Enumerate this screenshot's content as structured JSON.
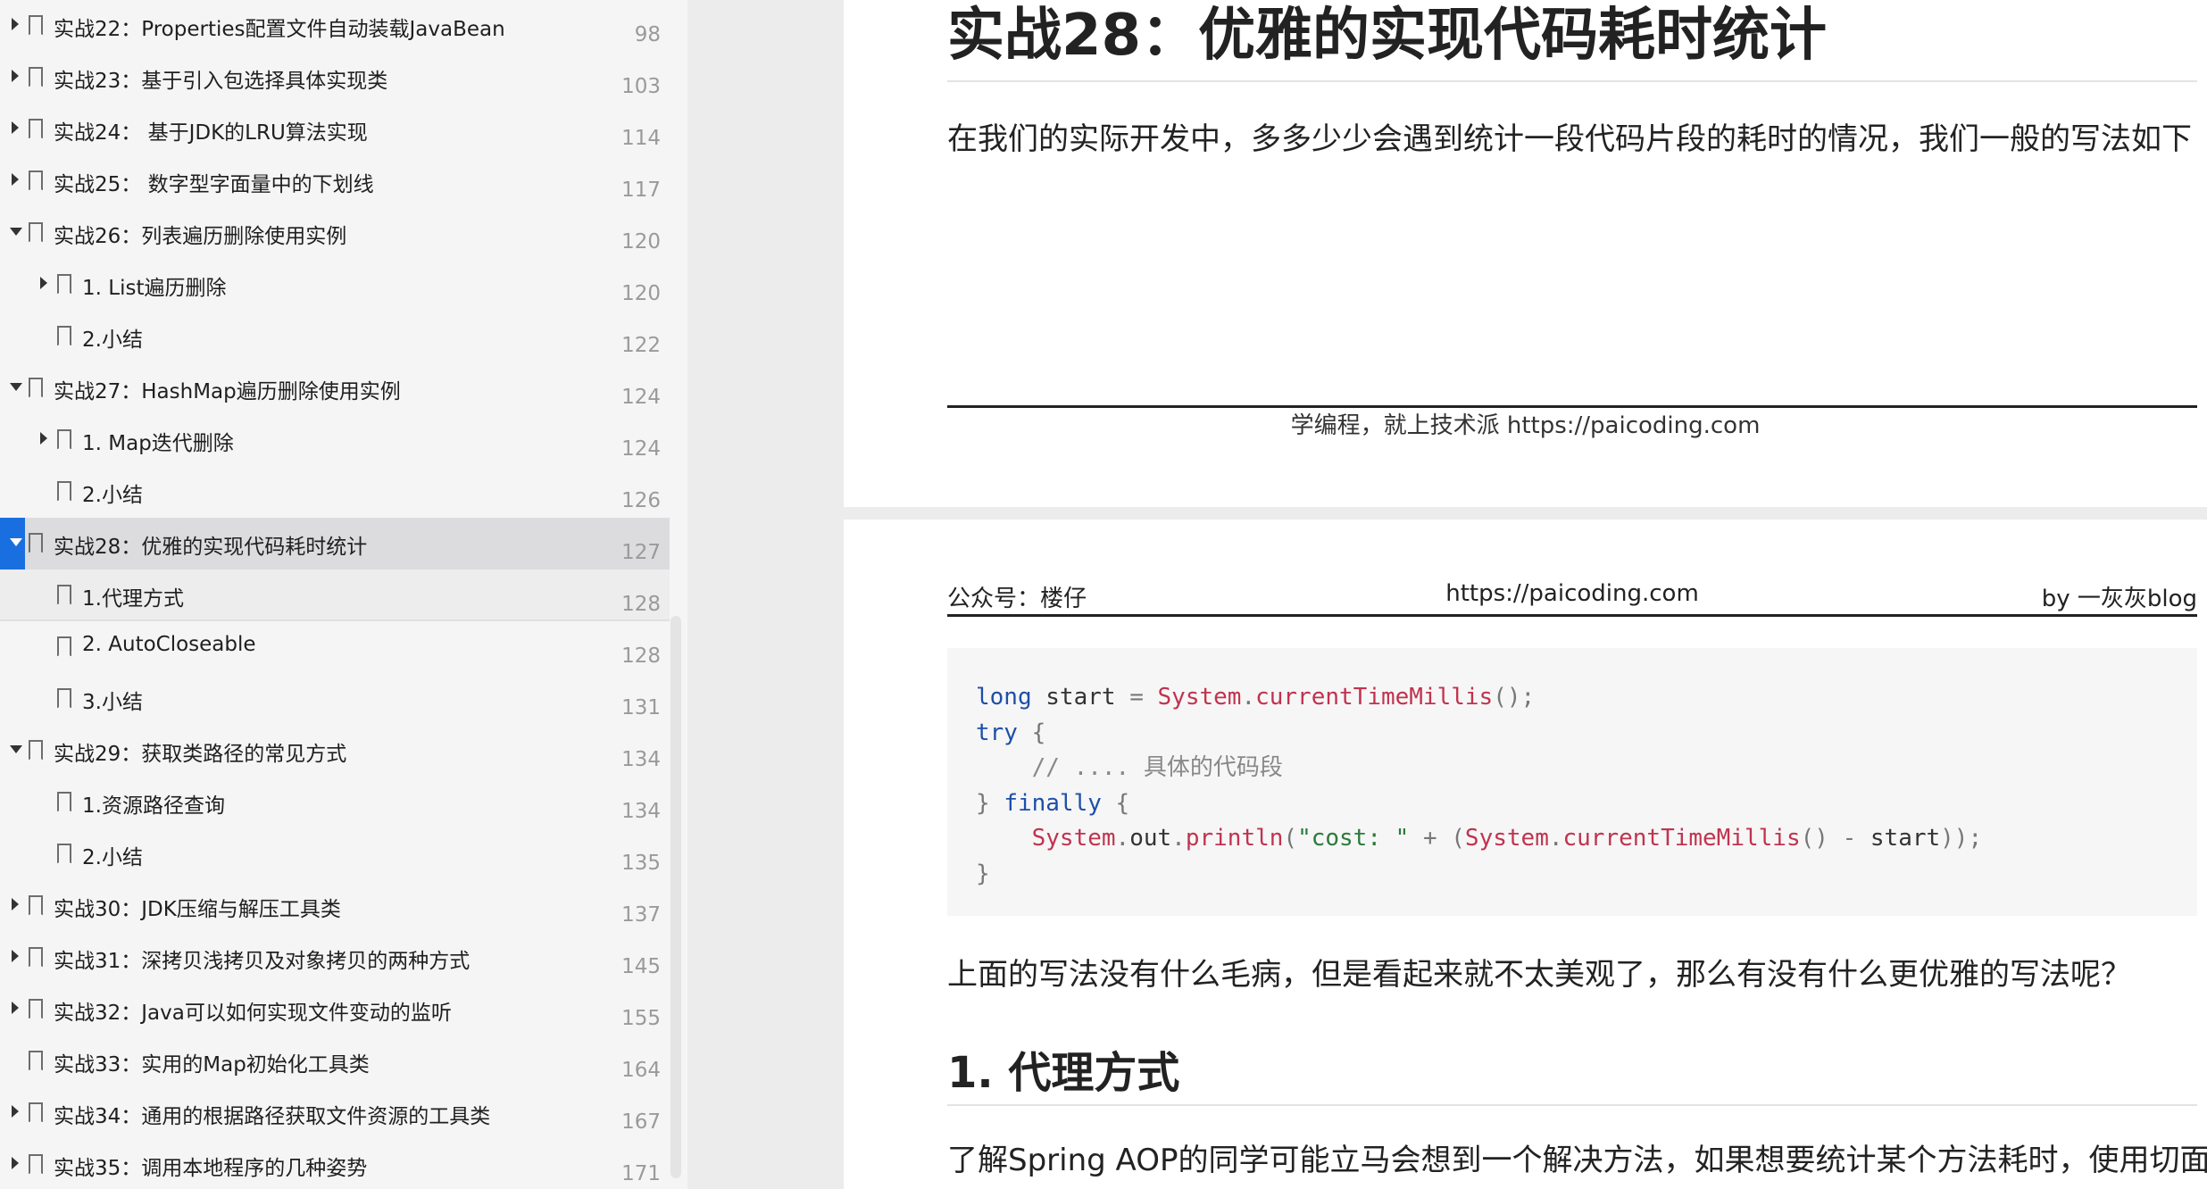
{
  "outline": {
    "items": [
      {
        "label": "实战22：Properties配置文件自动装载JavaBean",
        "page": "98",
        "level": 0,
        "arrow": "right"
      },
      {
        "label": "实战23：基于引入包选择具体实现类",
        "page": "103",
        "level": 0,
        "arrow": "right"
      },
      {
        "label": "实战24： 基于JDK的LRU算法实现",
        "page": "114",
        "level": 0,
        "arrow": "right"
      },
      {
        "label": "实战25： 数字型字面量中的下划线",
        "page": "117",
        "level": 0,
        "arrow": "right"
      },
      {
        "label": "实战26：列表遍历删除使用实例",
        "page": "120",
        "level": 0,
        "arrow": "down"
      },
      {
        "label": "1. List遍历删除",
        "page": "120",
        "level": 1,
        "arrow": "right"
      },
      {
        "label": "2.小结",
        "page": "122",
        "level": 1,
        "arrow": "none"
      },
      {
        "label": "实战27：HashMap遍历删除使用实例",
        "page": "124",
        "level": 0,
        "arrow": "down"
      },
      {
        "label": "1. Map迭代删除",
        "page": "124",
        "level": 1,
        "arrow": "right"
      },
      {
        "label": "2.小结",
        "page": "126",
        "level": 1,
        "arrow": "none"
      },
      {
        "label": "实战28：优雅的实现代码耗时统计",
        "page": "127",
        "level": 0,
        "arrow": "down",
        "selected": true
      },
      {
        "label": "1.代理方式",
        "page": "128",
        "level": 1,
        "arrow": "none",
        "hover": true
      },
      {
        "label": "2. AutoCloseable",
        "page": "128",
        "level": 1,
        "arrow": "none"
      },
      {
        "label": "3.小结",
        "page": "131",
        "level": 1,
        "arrow": "none"
      },
      {
        "label": "实战29：获取类路径的常见方式",
        "page": "134",
        "level": 0,
        "arrow": "down"
      },
      {
        "label": "1.资源路径查询",
        "page": "134",
        "level": 1,
        "arrow": "none"
      },
      {
        "label": "2.小结",
        "page": "135",
        "level": 1,
        "arrow": "none"
      },
      {
        "label": "实战30：JDK压缩与解压工具类",
        "page": "137",
        "level": 0,
        "arrow": "right"
      },
      {
        "label": "实战31：深拷贝浅拷贝及对象拷贝的两种方式",
        "page": "145",
        "level": 0,
        "arrow": "right"
      },
      {
        "label": "实战32：Java可以如何实现文件变动的监听",
        "page": "155",
        "level": 0,
        "arrow": "right"
      },
      {
        "label": "实战33：实用的Map初始化工具类",
        "page": "164",
        "level": 0,
        "arrow": "none"
      },
      {
        "label": "实战34：通用的根据路径获取文件资源的工具类",
        "page": "167",
        "level": 0,
        "arrow": "right"
      },
      {
        "label": "实战35：调用本地程序的几种姿势",
        "page": "171",
        "level": 0,
        "arrow": "right"
      }
    ]
  },
  "page1": {
    "title": "实战28：优雅的实现代码耗时统计",
    "intro": "在我们的实际开发中，多多少少会遇到统计一段代码片段的耗时的情况，我们一般的写法如下",
    "footer": "学编程，就上技术派 https://paicoding.com"
  },
  "page2": {
    "header_left": "公众号：楼仔",
    "header_center": "https://paicoding.com",
    "header_right": "by 一灰灰blog",
    "code_lines": [
      "long start = System.currentTimeMillis();",
      "try {",
      "    // .... 具体的代码段",
      "} finally {",
      "    System.out.println(\"cost: \" + (System.currentTimeMillis() - start));",
      "}"
    ],
    "para2": "上面的写法没有什么毛病，但是看起来就不太美观了，那么有没有什么更优雅的写法呢？",
    "section_heading": "1. 代理方式",
    "para3": "了解Spring AOP的同学可能立马会想到一个解决方法，如果想要统计某个方法耗时，使用切面可"
  }
}
